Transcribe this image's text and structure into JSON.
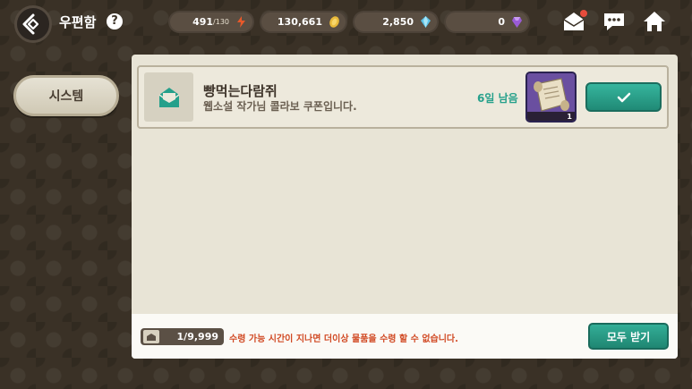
{
  "header": {
    "title": "우편함",
    "help": "?",
    "resources": [
      {
        "name": "stamina",
        "value": "491",
        "max": "/130",
        "icon": "stamina-icon",
        "color": "#e8592a"
      },
      {
        "name": "gold",
        "value": "130,661",
        "icon": "gold-coin-icon",
        "color": "#e8b93a"
      },
      {
        "name": "crystal",
        "value": "2,850",
        "icon": "crystal-icon",
        "color": "#5bc2e8"
      },
      {
        "name": "gem",
        "value": "0",
        "icon": "purple-gem-icon",
        "color": "#9a5bd6"
      }
    ]
  },
  "sidebar": {
    "tabs": [
      {
        "label": "시스템",
        "selected": true
      }
    ]
  },
  "mail": {
    "items": [
      {
        "title": "빵먹는다람쥐",
        "description": "웹소설 작가님 콜라보 쿠폰입니다.",
        "remaining": "6일 남음",
        "reward_count": "1",
        "reward_icon": "scroll-icon"
      }
    ]
  },
  "footer": {
    "count": "1/9,999",
    "warning": "수령 가능 시간이 지나면 더이상 물품을 수령 할 수 없습니다.",
    "claim_all": "모두 받기"
  },
  "colors": {
    "accent": "#25a08b",
    "warning": "#d14a24"
  }
}
